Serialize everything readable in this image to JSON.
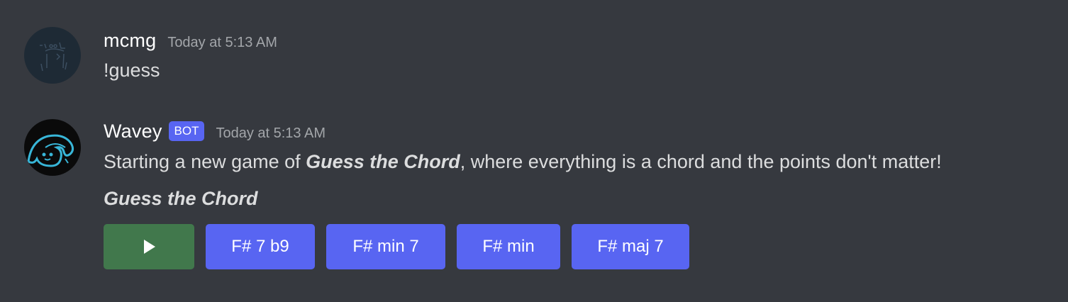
{
  "messages": [
    {
      "username": "mcmg",
      "timestamp": "Today at 5:13 AM",
      "content": "!guess"
    },
    {
      "username": "Wavey",
      "badge": "BOT",
      "timestamp": "Today at 5:13 AM",
      "content_prefix": "Starting a new game of ",
      "content_bold": "Guess the Chord",
      "content_suffix": ", where everything is a chord and the points don't matter!",
      "embed_title": "Guess the Chord",
      "buttons": {
        "play_icon": "play-icon",
        "choices": [
          "F# 7 b9",
          "F# min 7",
          "F# min",
          "F# maj 7"
        ]
      }
    }
  ],
  "colors": {
    "background": "#36393f",
    "blurple": "#5865f2",
    "play_green": "#41784c",
    "username": "#ffffff",
    "timestamp": "#a3a6aa",
    "text": "#dcddde"
  }
}
